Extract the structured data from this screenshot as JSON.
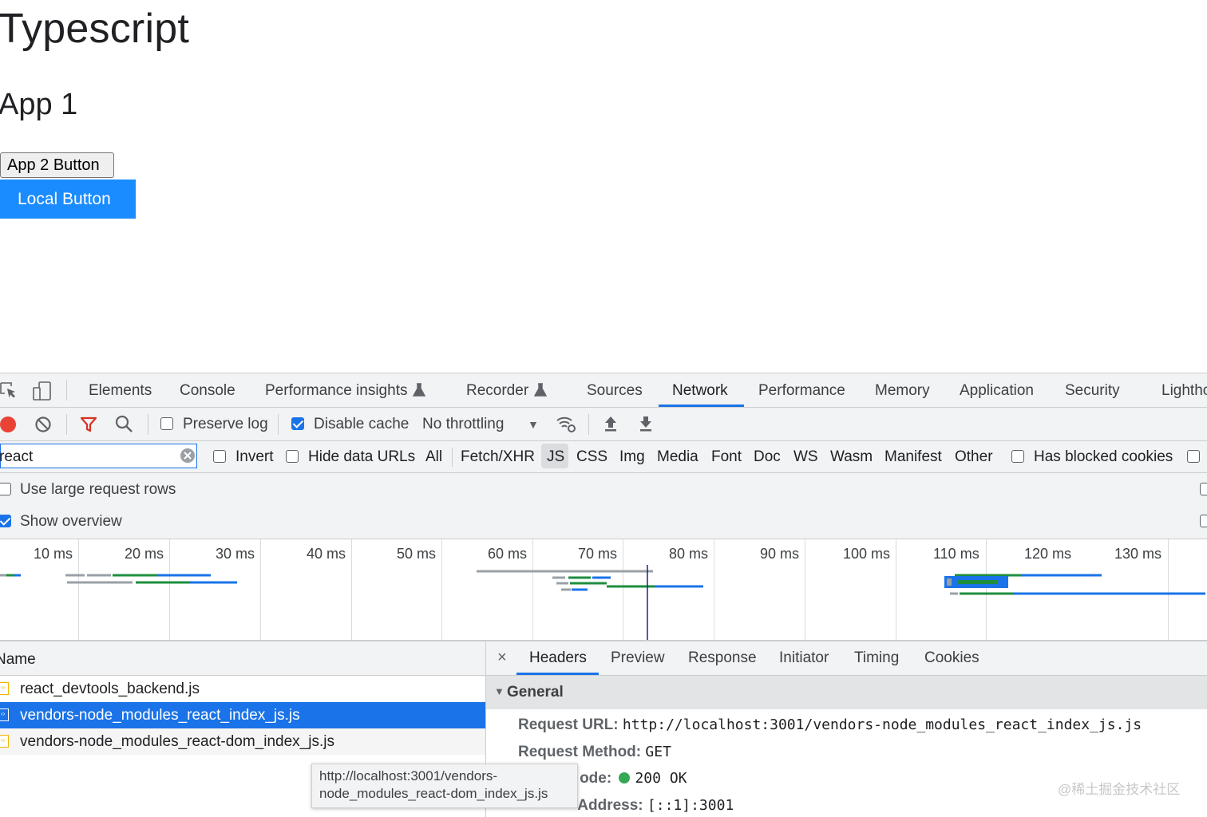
{
  "page": {
    "title": "Typescript",
    "subtitle": "App 1",
    "app2_button": "App 2 Button",
    "local_button": "Local Button"
  },
  "devtools": {
    "tabs": [
      "Elements",
      "Console",
      "Performance insights",
      "Recorder",
      "Sources",
      "Network",
      "Performance",
      "Memory",
      "Application",
      "Security",
      "Lighthc"
    ],
    "active_tab": "Network",
    "toolbar": {
      "preserve_log": "Preserve log",
      "preserve_log_checked": false,
      "disable_cache": "Disable cache",
      "disable_cache_checked": true,
      "throttling": "No throttling"
    },
    "filter": {
      "value": "react",
      "invert": "Invert",
      "hide_data_urls": "Hide data URLs",
      "types": [
        "All",
        "Fetch/XHR",
        "JS",
        "CSS",
        "Img",
        "Media",
        "Font",
        "Doc",
        "WS",
        "Wasm",
        "Manifest",
        "Other"
      ],
      "active_type": "JS",
      "has_blocked_cookies": "Has blocked cookies"
    },
    "options": {
      "large_rows": "Use large request rows",
      "large_rows_checked": false,
      "show_overview": "Show overview",
      "show_overview_checked": true
    },
    "overview_ticks": [
      "10 ms",
      "20 ms",
      "30 ms",
      "40 ms",
      "50 ms",
      "60 ms",
      "70 ms",
      "80 ms",
      "90 ms",
      "100 ms",
      "110 ms",
      "120 ms",
      "130 ms"
    ],
    "requests": {
      "header": "Name",
      "rows": [
        {
          "name": "react_devtools_backend.js",
          "selected": false
        },
        {
          "name": "vendors-node_modules_react_index_js.js",
          "selected": true
        },
        {
          "name": "vendors-node_modules_react-dom_index_js.js",
          "selected": false
        }
      ]
    },
    "details": {
      "close": "×",
      "tabs": [
        "Headers",
        "Preview",
        "Response",
        "Initiator",
        "Timing",
        "Cookies"
      ],
      "active_tab": "Headers",
      "section": "General",
      "request_url_label": "Request URL:",
      "request_url": "http://localhost:3001/vendors-node_modules_react_index_js.js",
      "request_method_label": "Request Method:",
      "request_method": "GET",
      "status_label": "ode:",
      "status": "200 OK",
      "remote_label": "Address:",
      "remote": "[::1]:3001"
    },
    "tooltip": {
      "line1": "http://localhost:3001/vendors-",
      "line2": "node_modules_react-dom_index_js.js"
    }
  },
  "watermark": "@稀土掘金技术社区",
  "colors": {
    "accent": "#1a73e8",
    "local_button": "#1a8cff",
    "record": "#ea4335",
    "filter_icon": "#d93025",
    "status_ok": "#34a853"
  }
}
